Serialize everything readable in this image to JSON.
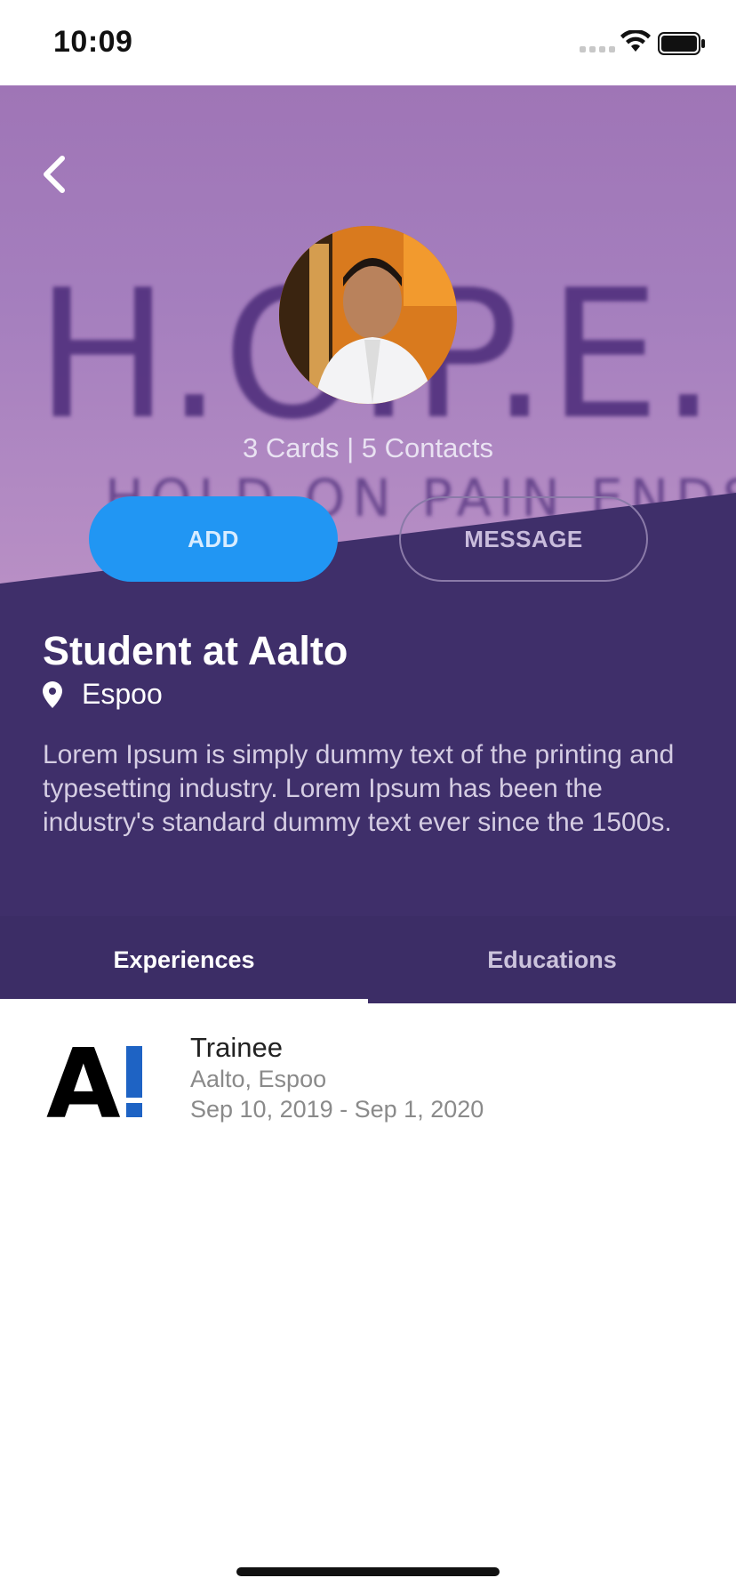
{
  "status_bar": {
    "time": "10:09"
  },
  "header": {
    "cover_text": "H.O.P.E.",
    "cover_subtext": "HOLD ON PAIN ENDS",
    "counts": "3 Cards | 5 Contacts",
    "add_label": "ADD",
    "message_label": "MESSAGE"
  },
  "profile": {
    "title": "Student at Aalto",
    "location": "Espoo",
    "bio": "Lorem Ipsum is simply dummy text of the printing and typesetting industry. Lorem Ipsum has been the industry's standard dummy text ever since the 1500s."
  },
  "tabs": [
    {
      "label": "Experiences",
      "active": true
    },
    {
      "label": "Educations",
      "active": false
    }
  ],
  "experiences": [
    {
      "logo_text": "A!",
      "role": "Trainee",
      "company": "Aalto, Espoo",
      "dates": "Sep 10, 2019 - Sep 1, 2020"
    }
  ],
  "colors": {
    "accent": "#2196f3",
    "profile_bg": "#3f2f6a",
    "aalto_blue": "#1e63c4"
  }
}
